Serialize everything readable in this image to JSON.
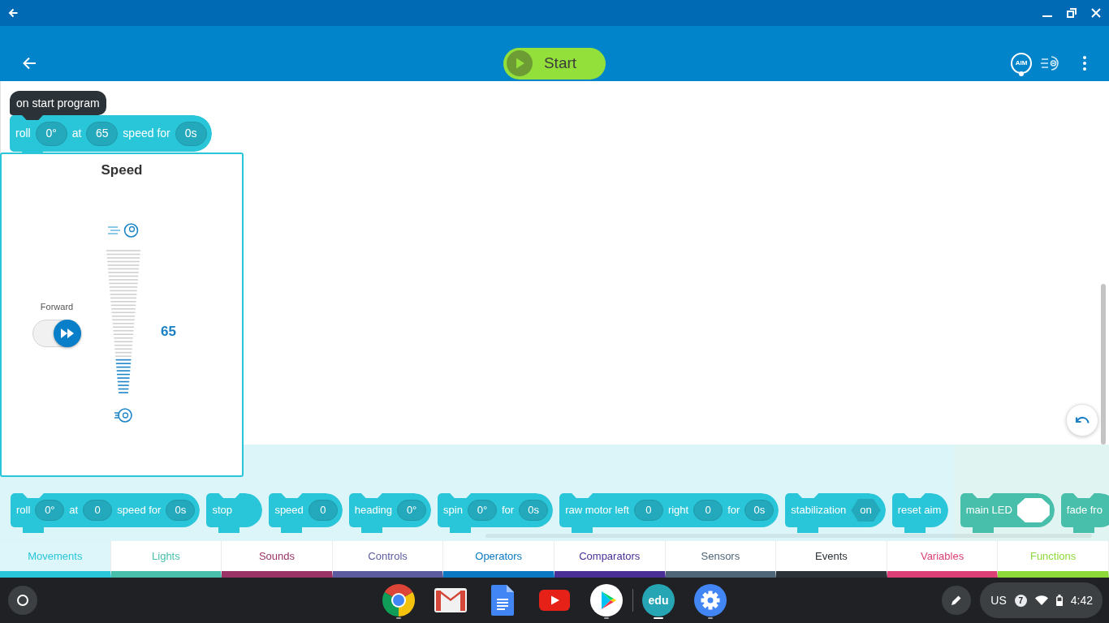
{
  "header": {
    "start_button": {
      "label": "Start"
    },
    "aim_button": {
      "label": "AIM"
    }
  },
  "canvas": {
    "blocks": [
      {
        "kind": "hat",
        "color": "#2b3238",
        "parts": [
          {
            "kind": "text",
            "text": "on start program"
          }
        ]
      },
      {
        "kind": "stack",
        "color": "#29c5d9",
        "parts": [
          {
            "kind": "text",
            "text": "roll"
          },
          {
            "kind": "number",
            "text": "0°"
          },
          {
            "kind": "text",
            "text": "at"
          },
          {
            "kind": "number",
            "text": "65"
          },
          {
            "kind": "text",
            "text": "speed for"
          },
          {
            "kind": "number",
            "text": "0s"
          }
        ]
      }
    ]
  },
  "speed_popup": {
    "title": "Speed",
    "direction": {
      "label": "Forward",
      "on": true
    },
    "level": 0.25,
    "value": "65"
  },
  "palette": {
    "sections": [
      {
        "color": "#29c5d9",
        "blocks": [
          {
            "kind": "stack",
            "parts": [
              {
                "kind": "text",
                "text": "roll"
              },
              {
                "kind": "number",
                "text": "0°"
              },
              {
                "kind": "text",
                "text": "at"
              },
              {
                "kind": "number",
                "text": "0"
              },
              {
                "kind": "text",
                "text": "speed for"
              },
              {
                "kind": "number",
                "text": "0s"
              }
            ]
          },
          {
            "kind": "stack",
            "parts": [
              {
                "kind": "text",
                "text": "stop"
              }
            ]
          },
          {
            "kind": "stack",
            "parts": [
              {
                "kind": "text",
                "text": "speed"
              },
              {
                "kind": "number",
                "text": "0"
              }
            ]
          },
          {
            "kind": "stack",
            "parts": [
              {
                "kind": "text",
                "text": "heading"
              },
              {
                "kind": "number",
                "text": "0°"
              }
            ]
          },
          {
            "kind": "stack",
            "parts": [
              {
                "kind": "text",
                "text": "spin"
              },
              {
                "kind": "number",
                "text": "0°"
              },
              {
                "kind": "text",
                "text": "for"
              },
              {
                "kind": "number",
                "text": "0s"
              }
            ]
          },
          {
            "kind": "stack",
            "parts": [
              {
                "kind": "text",
                "text": "raw motor left"
              },
              {
                "kind": "number",
                "text": "0"
              },
              {
                "kind": "text",
                "text": "right"
              },
              {
                "kind": "number",
                "text": "0"
              },
              {
                "kind": "text",
                "text": "for"
              },
              {
                "kind": "number",
                "text": "0s"
              }
            ]
          },
          {
            "kind": "stack",
            "parts": [
              {
                "kind": "text",
                "text": "stabilization"
              },
              {
                "kind": "boolean",
                "text": "on"
              }
            ]
          },
          {
            "kind": "stack",
            "parts": [
              {
                "kind": "text",
                "text": "reset aim"
              }
            ]
          }
        ]
      },
      {
        "color": "#47bfaa",
        "blocks": [
          {
            "kind": "stack",
            "parts": [
              {
                "kind": "text",
                "text": "main LED"
              },
              {
                "kind": "color",
                "color": "#ffffff"
              }
            ]
          },
          {
            "kind": "stack",
            "parts": [
              {
                "kind": "text",
                "text": "fade fro"
              }
            ]
          }
        ]
      }
    ]
  },
  "categories": [
    {
      "label": "Movements",
      "color": "#29c5d9",
      "selected": true
    },
    {
      "label": "Lights",
      "color": "#47bfaa",
      "selected": false
    },
    {
      "label": "Sounds",
      "color": "#9b3366",
      "selected": false
    },
    {
      "label": "Controls",
      "color": "#5c5ba0",
      "selected": false
    },
    {
      "label": "Operators",
      "color": "#0a78c2",
      "selected": false
    },
    {
      "label": "Comparators",
      "color": "#4a2f96",
      "selected": false
    },
    {
      "label": "Sensors",
      "color": "#4e6678",
      "selected": false
    },
    {
      "label": "Events",
      "color": "#2b3238",
      "selected": false
    },
    {
      "label": "Variables",
      "color": "#db3f76",
      "selected": false
    },
    {
      "label": "Functions",
      "color": "#8ed93a",
      "selected": false
    }
  ],
  "shelf": {
    "groups": [
      {
        "apps": [
          {
            "kind": "chrome",
            "running": true,
            "selected": false
          },
          {
            "kind": "gmail",
            "running": false,
            "selected": false
          },
          {
            "kind": "docs",
            "running": false,
            "selected": false
          },
          {
            "kind": "youtube",
            "running": false,
            "selected": false
          },
          {
            "kind": "play",
            "running": true,
            "selected": false
          }
        ]
      },
      {
        "apps": [
          {
            "kind": "edu",
            "label": "edu",
            "running": true,
            "selected": true
          },
          {
            "kind": "settings",
            "running": true,
            "selected": false
          }
        ]
      }
    ],
    "tray": {
      "layout": "US",
      "notifications": "7",
      "time": "4:42"
    }
  }
}
